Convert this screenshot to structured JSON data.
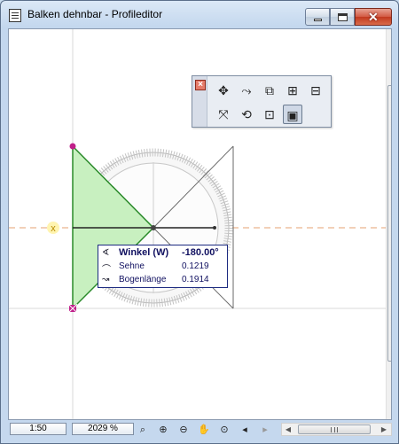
{
  "window": {
    "title": "Balken dehnbar - Profileditor",
    "minimize_glyph": "",
    "maximize_glyph": "",
    "close_glyph": "✕"
  },
  "canvas": {
    "origin_marker": "x",
    "colors": {
      "fill_green": "#c8f0c0",
      "stroke_green": "#2a8a2a",
      "magenta_node": "#c0208a",
      "guide_line": "#d9d9d9",
      "dashed_orange": "#e6a070",
      "protractor_gray": "#b0b0b0"
    }
  },
  "palette": {
    "close_glyph": "×",
    "tools": [
      {
        "name": "move-tool-icon",
        "glyph": "✥"
      },
      {
        "name": "rotate-drag-tool-icon",
        "glyph": "⤳"
      },
      {
        "name": "mirror-tool-icon",
        "glyph": "⧉"
      },
      {
        "name": "multiply-tool-icon",
        "glyph": "⊞"
      },
      {
        "name": "offset-tool-icon",
        "glyph": "⊟"
      },
      {
        "name": "drag-copy-tool-icon",
        "glyph": "⤧"
      },
      {
        "name": "rotate-tool-icon",
        "glyph": "⟲"
      },
      {
        "name": "stretch-tool-icon",
        "glyph": "⊡"
      },
      {
        "name": "resize-tool-icon",
        "glyph": "▣"
      }
    ]
  },
  "tooltip": {
    "rows": [
      {
        "icon": "∢",
        "label": "Winkel (W)",
        "value": "-180.00°"
      },
      {
        "icon": "⌒",
        "label": "Sehne",
        "value": "0.1219"
      },
      {
        "icon": "↝",
        "label": "Bogenlänge",
        "value": "0.1914"
      }
    ]
  },
  "statusbar": {
    "scale": "1:50",
    "zoom": "2029 %",
    "buttons": [
      {
        "name": "zoom-options-icon",
        "glyph": "⌕"
      },
      {
        "name": "zoom-in-icon",
        "glyph": "⊕"
      },
      {
        "name": "zoom-out-icon",
        "glyph": "⊖"
      },
      {
        "name": "pan-hand-icon",
        "glyph": "✋"
      },
      {
        "name": "fit-in-window-icon",
        "glyph": "⊙"
      },
      {
        "name": "previous-zoom-icon",
        "glyph": "◂"
      },
      {
        "name": "next-zoom-icon",
        "glyph": "▸"
      }
    ]
  }
}
